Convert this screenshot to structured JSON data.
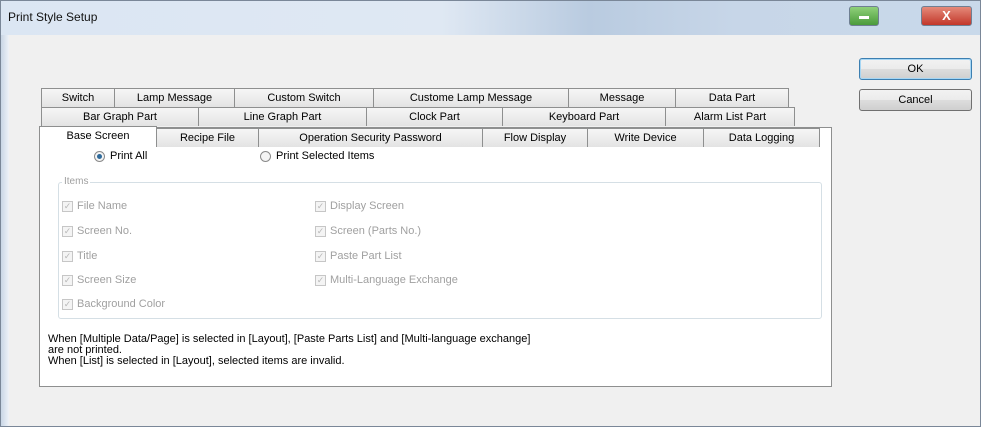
{
  "window": {
    "title": "Print Style Setup",
    "close_glyph": "X"
  },
  "tabs": {
    "row1": [
      "Switch",
      "Lamp Message",
      "Custom Switch",
      "Custome Lamp Message",
      "Message",
      "Data Part"
    ],
    "row2": [
      "Bar Graph Part",
      "Line Graph Part",
      "Clock Part",
      "Keyboard Part",
      "Alarm List Part"
    ],
    "row3": [
      "Base Screen",
      "Recipe File",
      "Operation Security Password",
      "Flow Display",
      "Write Device",
      "Data Logging"
    ],
    "active": "Base Screen"
  },
  "buttons": {
    "ok": "OK",
    "cancel": "Cancel"
  },
  "print_mode": {
    "options": [
      "Print All",
      "Print Selected Items"
    ],
    "selected": "Print All"
  },
  "items_group": {
    "label": "Items",
    "left_items": [
      "File Name",
      "Screen No.",
      "Title",
      "Screen Size",
      "Background Color"
    ],
    "right_items": [
      "Display Screen",
      "Screen (Parts No.)",
      "Paste Part List",
      "Multi-Language Exchange"
    ]
  },
  "notes": [
    "When [Multiple Data/Page] is selected in [Layout], [Paste Parts List] and [Multi-language exchange]",
    "are not printed.",
    "When [List] is selected in [Layout], selected items are invalid."
  ]
}
